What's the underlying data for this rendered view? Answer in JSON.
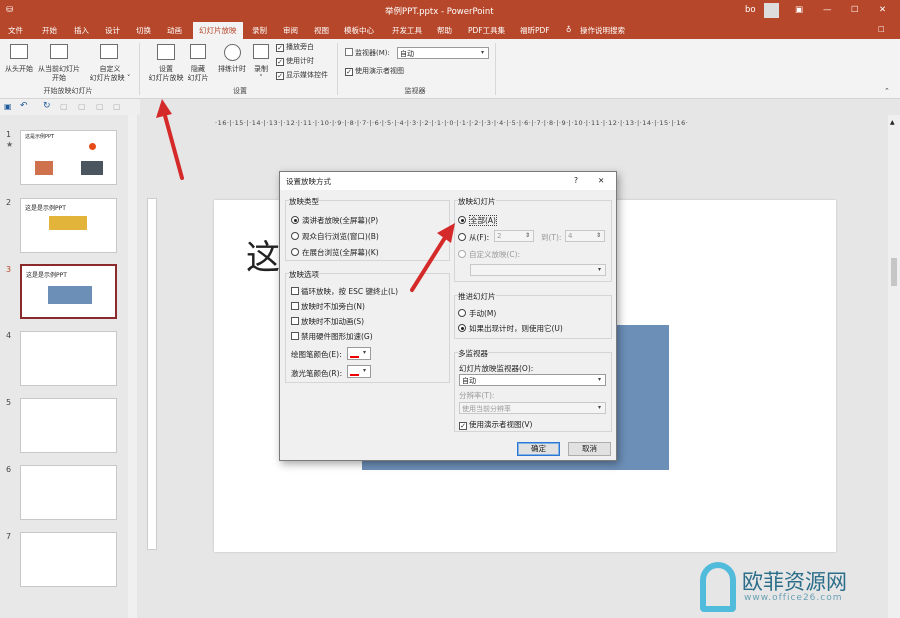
{
  "titlebar": {
    "title": "举例PPT.pptx  -  PowerPoint",
    "user": "bo",
    "controls": [
      "▣",
      "—",
      "☐",
      "✕"
    ]
  },
  "tabs": [
    "文件",
    "开始",
    "插入",
    "设计",
    "切换",
    "动画",
    "幻灯片放映",
    "录制",
    "审阅",
    "视图",
    "模板中心",
    "开发工具",
    "帮助",
    "PDF工具集",
    "福昕PDF",
    "操作说明搜索"
  ],
  "ribbon": {
    "from_start": "从头开始",
    "from_current_1": "从当前幻灯片",
    "from_current_2": "开始",
    "custom_1": "自定义",
    "custom_2": "幻灯片放映 ˅",
    "group_start": "开始放映幻灯片",
    "setup_1": "设置",
    "setup_2": "幻灯片放映",
    "hide_1": "隐藏",
    "hide_2": "幻灯片",
    "rehearse": "排练计时",
    "record": "录制",
    "record_arrow": "˅",
    "cb_narration": "播放旁白",
    "cb_timing": "使用计时",
    "cb_media": "显示媒体控件",
    "group_setup": "设置",
    "monitor_label": "监视器(M):",
    "monitor_value": "自动",
    "presenter_view": "使用演示者视图",
    "group_monitor": "监视器"
  },
  "slides": {
    "numbers": [
      "1",
      "2",
      "3",
      "4",
      "5",
      "6",
      "7"
    ],
    "s1_title": "这是示例PPT",
    "s2_title": "这是是示例PPT",
    "s3_title": "这是是示例PPT",
    "star": "★"
  },
  "hruler": "·16·|·15·|·14·|·13·|·12·|·11·|·10·|·9·|·8·|·7·|·6·|·5·|·4·|·3·|·2·|·1·|·0·|·1·|·2·|·3·|·4·|·5·|·6·|·7·|·8·|·9·|·10·|·11·|·12·|·13·|·14·|·15·|·16·",
  "slide": {
    "text": "这"
  },
  "dialog": {
    "title": "设置放映方式",
    "help": "?",
    "close": "✕",
    "show_type": "放映类型",
    "type_1": "演讲者放映(全屏幕)(P)",
    "type_2": "观众自行浏览(窗口)(B)",
    "type_3": "在展台浏览(全屏幕)(K)",
    "options": "放映选项",
    "opt_1": "循环放映，按 ESC 键终止(L)",
    "opt_2": "放映时不加旁白(N)",
    "opt_3": "放映时不加动画(S)",
    "opt_4": "禁用硬件图形加速(G)",
    "pen_color": "绘图笔颜色(E):",
    "laser_color": "激光笔颜色(R):",
    "slides_group": "放映幻灯片",
    "all": "全部(A)",
    "from": "从(F):",
    "from_val": "2",
    "to": "到(T):",
    "to_val": "4",
    "custom_show": "自定义放映(C):",
    "advance": "推进幻灯片",
    "manual": "手动(M)",
    "timing": "如果出现计时，则使用它(U)",
    "multi": "多监视器",
    "monitor_label": "幻灯片放映监视器(O):",
    "monitor_val": "自动",
    "resolution": "分辨率(T):",
    "resolution_val": "使用当前分辨率",
    "presenter": "使用演示者视图(V)",
    "ok": "确定",
    "cancel": "取消"
  },
  "watermark": {
    "text": "欧菲资源网",
    "url": "www.office26.com"
  },
  "colors": {
    "accent": "#b7472a",
    "highlight": "#6c8fb8",
    "arrow": "#d42a2a"
  }
}
